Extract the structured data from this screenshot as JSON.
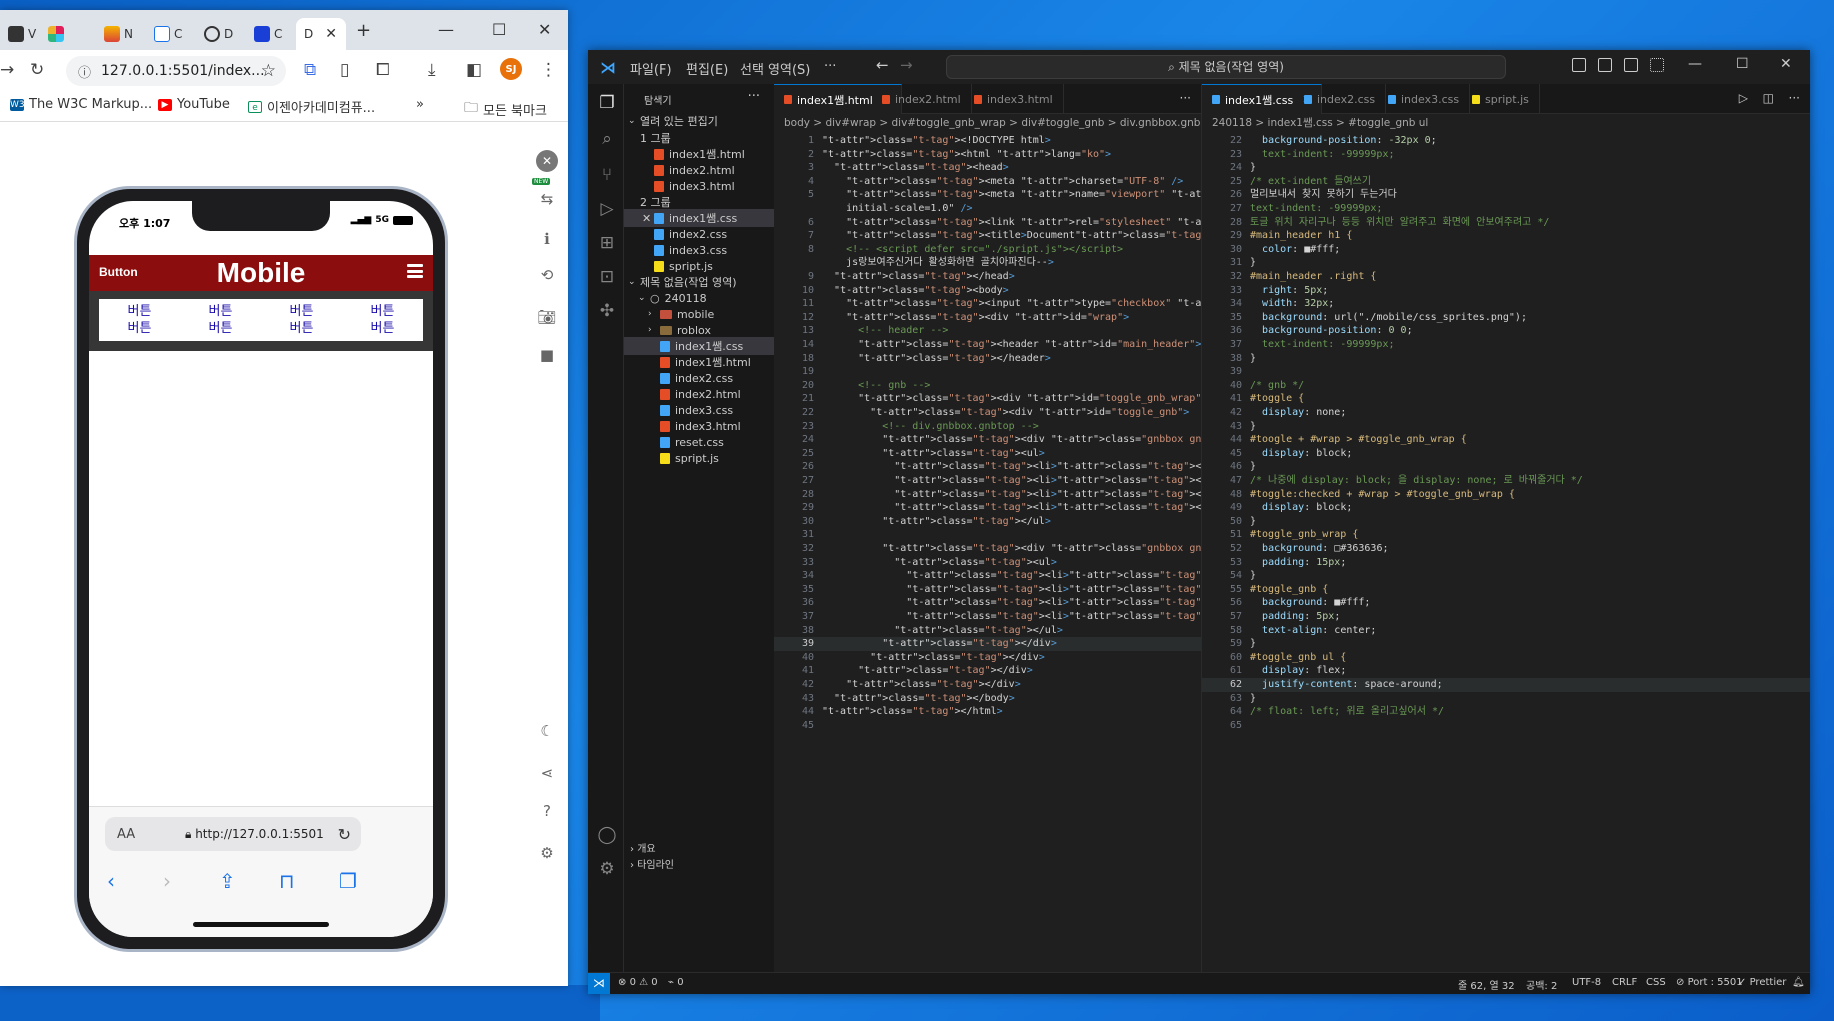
{
  "browser": {
    "tabs": [
      "V",
      "",
      "N",
      "C",
      "D",
      "C",
      "D"
    ],
    "new_tab": "+",
    "url": "127.0.0.1:5501/index...",
    "profile_initials": "SJ",
    "bookmarks": [
      "The W3C Markup...",
      "YouTube",
      "이젠아카데미컴퓨...",
      "»",
      "모든 북마크"
    ],
    "side_badge": "NEW"
  },
  "phone": {
    "time": "오후 1:07",
    "network": "5G",
    "header_button": "Button",
    "header_title": "Mobile",
    "gnbtop": [
      "버튼",
      "버튼",
      "버튼",
      "버튼"
    ],
    "gnbbottom": [
      "버튼",
      "버튼",
      "버튼",
      "버튼"
    ],
    "aa": "AA",
    "url": "http://127.0.0.1:5501"
  },
  "vscode": {
    "menus": [
      "파일(F)",
      "편집(E)",
      "선택 영역(S)",
      "···"
    ],
    "command_center": "제목 없음(작업 영역)",
    "explorer": {
      "title": "탐색기",
      "open_editors": "열려 있는 편집기",
      "group1": "1 그룹",
      "group1_files": [
        "index1쌤.html",
        "index2.html",
        "index3.html"
      ],
      "group2": "2 그룹",
      "group2_files": [
        "index1쌤.css",
        "index2.css",
        "index3.css",
        "spript.js"
      ],
      "workspace": "제목 없음(작업 영역)",
      "folder": "240118",
      "subfolders": [
        "mobile",
        "roblox"
      ],
      "files": [
        "index1쌤.css",
        "index1쌤.html",
        "index2.css",
        "index2.html",
        "index3.css",
        "index3.html",
        "reset.css",
        "spript.js"
      ],
      "outline": "개요",
      "timeline": "타임라인"
    },
    "left_tabs": [
      "index1쌤.html",
      "index2.html",
      "index3.html"
    ],
    "left_breadcrumb": "body > div#wrap > div#toggle_gnb_wrap > div#toggle_gnb > div.gnbbox.gnbbottom",
    "right_tabs": [
      "index1쌤.css",
      "index2.css",
      "index3.css",
      "spript.js"
    ],
    "right_breadcrumb": "240118 > index1쌤.css > #toggle_gnb ul",
    "status": {
      "errors": "0",
      "warnings": "0",
      "ports": "0",
      "position": "줄 62, 열 32",
      "spaces": "공백: 2",
      "encoding": "UTF-8",
      "eol": "CRLF",
      "language": "CSS",
      "port": "Port : 5501",
      "prettier": "Prettier"
    }
  }
}
